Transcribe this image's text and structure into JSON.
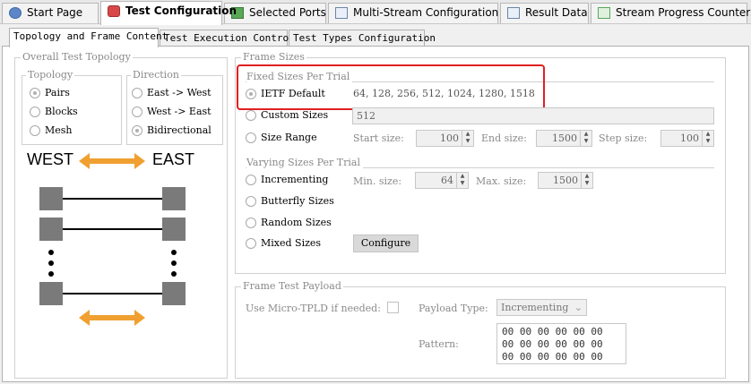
{
  "tabs": [
    {
      "label": "Start Page"
    },
    {
      "label": "Test Configuration"
    },
    {
      "label": "Selected Ports"
    },
    {
      "label": "Multi-Stream Configuration"
    },
    {
      "label": "Result Data"
    },
    {
      "label": "Stream Progress Counters"
    }
  ],
  "subtabs": [
    {
      "label": "Topology and Frame Content"
    },
    {
      "label": "Test Execution Control"
    },
    {
      "label": "Test Types Configuration"
    }
  ],
  "topology_group": {
    "title": "Overall Test Topology",
    "topology_title": "Topology",
    "topology_options": [
      "Pairs",
      "Blocks",
      "Mesh"
    ],
    "topology_selected": "Pairs",
    "direction_title": "Direction",
    "direction_options": [
      "East -> West",
      "West -> East",
      "Bidirectional"
    ],
    "direction_selected": "Bidirectional",
    "west_label": "WEST",
    "east_label": "EAST"
  },
  "frame_sizes": {
    "title": "Frame Sizes",
    "fixed_title": "Fixed Sizes Per Trial",
    "ietf_label": "IETF Default",
    "ietf_value": "64, 128, 256, 512, 1024, 1280, 1518",
    "custom_label": "Custom Sizes",
    "custom_value": "512",
    "range_label": "Size Range",
    "start_label": "Start size:",
    "start_value": "100",
    "end_label": "End size:",
    "end_value": "1500",
    "step_label": "Step size:",
    "step_value": "100",
    "varying_title": "Varying Sizes Per Trial",
    "incrementing_label": "Incrementing",
    "min_label": "Min. size:",
    "min_value": "64",
    "max_label": "Max. size:",
    "max_value": "1500",
    "butterfly_label": "Butterfly Sizes",
    "random_label": "Random Sizes",
    "mixed_label": "Mixed Sizes",
    "configure_label": "Configure",
    "highlight_color": "#e02020"
  },
  "payload": {
    "title": "Frame Test Payload",
    "micro_tpld_label": "Use Micro-TPLD if needed:",
    "payload_type_label": "Payload Type:",
    "payload_type_value": "Incrementing",
    "pattern_label": "Pattern:",
    "pattern_lines": [
      "00 00 00 00 00 00",
      "00 00 00 00 00 00",
      "00 00 00 00 00 00"
    ]
  },
  "colors": {
    "arrow": "#f0a030",
    "accent_red": "#e02020"
  }
}
